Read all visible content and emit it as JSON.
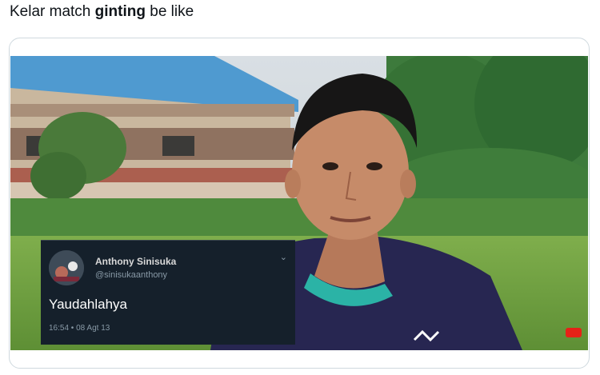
{
  "caption": {
    "part1": "Kelar match ",
    "bold": "ginting",
    "part2": " be like"
  },
  "embedded_tweet": {
    "display_name": "Anthony Sinisuka",
    "handle": "@sinisukaanthony",
    "text": "Yaudahlahya",
    "timestamp": "16:54 • 08 Agt 13"
  },
  "colors": {
    "tweet_bg": "#15202b",
    "caption_text": "#0f1419",
    "card_border": "#cfd9de"
  },
  "icons": {
    "caret": "chevron-down-icon",
    "brand_logo": "yonex-logo-icon"
  }
}
